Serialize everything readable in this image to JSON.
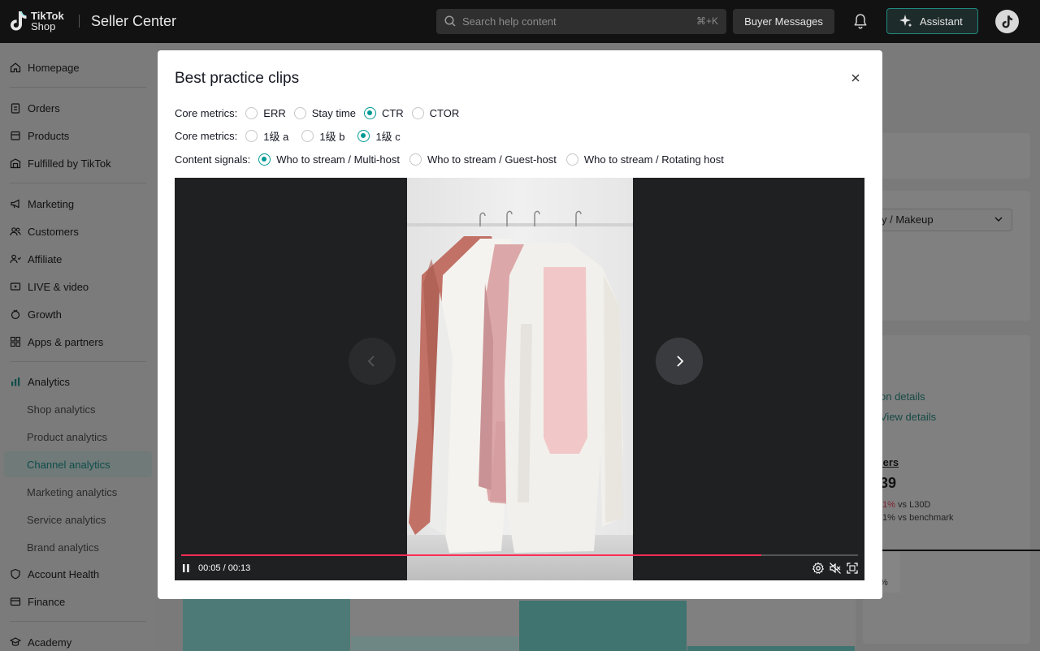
{
  "topbar": {
    "logo_line1": "TikTok",
    "logo_line2": "Shop",
    "app_title": "Seller Center",
    "search_placeholder": "Search help content",
    "search_shortcut": "⌘+K",
    "buyer_messages": "Buyer Messages",
    "assistant": "Assistant",
    "accent_color": "#1f8a7e"
  },
  "sidebar": {
    "items": [
      {
        "label": "Homepage",
        "icon": "home-icon"
      },
      {
        "label": "Orders",
        "icon": "clipboard-icon"
      },
      {
        "label": "Products",
        "icon": "box-icon"
      },
      {
        "label": "Fulfilled by TikTok",
        "icon": "warehouse-icon"
      },
      {
        "label": "Marketing",
        "icon": "megaphone-icon"
      },
      {
        "label": "Customers",
        "icon": "users-icon"
      },
      {
        "label": "Affiliate",
        "icon": "affiliate-icon"
      },
      {
        "label": "LIVE & video",
        "icon": "video-icon"
      },
      {
        "label": "Growth",
        "icon": "growth-icon"
      },
      {
        "label": "Apps & partners",
        "icon": "apps-icon"
      },
      {
        "label": "Analytics",
        "icon": "chart-icon"
      },
      {
        "label": "Account Health",
        "icon": "shield-icon"
      },
      {
        "label": "Finance",
        "icon": "wallet-icon"
      },
      {
        "label": "Academy",
        "icon": "academy-icon"
      }
    ],
    "analytics_sub": [
      "Shop analytics",
      "Product analytics",
      "Channel analytics",
      "Marketing analytics",
      "Service analytics",
      "Brand analytics"
    ],
    "active_item": "Channel analytics"
  },
  "background": {
    "dropdown_value": "y / Makeup",
    "link1": "on details",
    "link2": "View  details",
    "metric_label": "lers",
    "metric_value": "39",
    "trend1_value": ".1%",
    "trend1_suffix": " vs L30D",
    "trend2_value": ".1%",
    "trend2_suffix": " vs benchmark",
    "pct": "%"
  },
  "modal": {
    "title": "Best practice clips",
    "rows": [
      {
        "label": "Core metrics:",
        "options": [
          "ERR",
          "Stay time",
          "CTR",
          "CTOR"
        ],
        "selected": "CTR"
      },
      {
        "label": "Core metrics:",
        "options": [
          "1级 a",
          "1级 b",
          "1级 c"
        ],
        "selected": "1级 c"
      },
      {
        "label": "Content signals:",
        "options": [
          "Who to stream / Multi-host",
          "Who to stream / Guest-host",
          "Who to stream / Rotating host"
        ],
        "selected": "Who to stream / Multi-host"
      }
    ],
    "player": {
      "time": "00:05 / 00:13",
      "progress": 0.857,
      "progress_color": "#fe2c55"
    }
  }
}
